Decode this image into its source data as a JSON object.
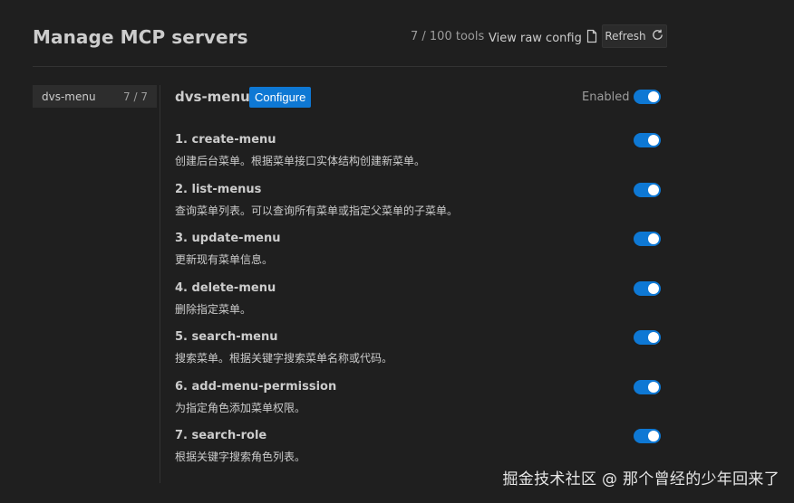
{
  "header": {
    "title": "Manage MCP servers",
    "tools_count": "7 / 100 tools",
    "raw_config_label": "View raw config",
    "refresh_label": "Refresh"
  },
  "sidebar": {
    "servers": [
      {
        "name": "dvs-menu",
        "count": "7 / 7"
      }
    ]
  },
  "detail": {
    "server_name": "dvs-menu",
    "configure_label": "Configure",
    "enabled_label": "Enabled",
    "enabled": true,
    "tools": [
      {
        "name": "1. create-menu",
        "description": "创建后台菜单。根据菜单接口实体结构创建新菜单。",
        "enabled": true
      },
      {
        "name": "2. list-menus",
        "description": "查询菜单列表。可以查询所有菜单或指定父菜单的子菜单。",
        "enabled": true
      },
      {
        "name": "3. update-menu",
        "description": "更新现有菜单信息。",
        "enabled": true
      },
      {
        "name": "4. delete-menu",
        "description": "删除指定菜单。",
        "enabled": true
      },
      {
        "name": "5. search-menu",
        "description": "搜索菜单。根据关键字搜索菜单名称或代码。",
        "enabled": true
      },
      {
        "name": "6. add-menu-permission",
        "description": "为指定角色添加菜单权限。",
        "enabled": true
      },
      {
        "name": "7. search-role",
        "description": "根据关键字搜索角色列表。",
        "enabled": true
      }
    ]
  },
  "watermark": "掘金技术社区 @ 那个曾经的少年回来了",
  "colors": {
    "background": "#1f1f1f",
    "accent": "#0e78d4",
    "text": "#cccccc",
    "muted": "#9d9d9d"
  }
}
